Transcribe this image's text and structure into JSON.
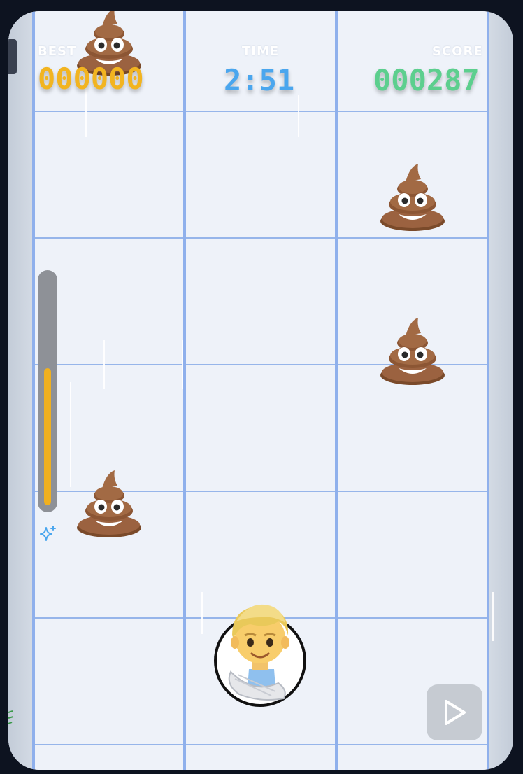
{
  "hud": {
    "best_label": "BEST",
    "best_value": "000000",
    "time_label": "TIME",
    "time_value": "2:51",
    "score_label": "SCORE",
    "score_value": "000287"
  },
  "colors": {
    "best": "#f2b420",
    "time": "#4aa6ee",
    "score": "#5ccf8e",
    "lane_line": "#8fb0ec",
    "meter_fill": "#f0b01f",
    "meter_track": "#8e9197"
  },
  "game": {
    "lanes": 3,
    "player_icon": "man-emoji-icon",
    "obstacle_icon": "poop-emoji-icon",
    "power_meter_level": 0.6,
    "power_icon": "sparkle-icon"
  },
  "controls": {
    "play_icon": "play-icon"
  }
}
